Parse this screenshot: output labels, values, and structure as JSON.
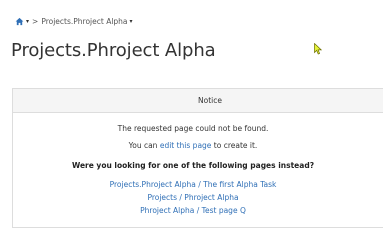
{
  "breadcrumb": {
    "home_icon": "home-icon",
    "caret": "▾",
    "separator": ">",
    "current": "Projects.Phroject Alpha"
  },
  "page_title": "Projects.Phroject Alpha",
  "notice": {
    "header": "Notice",
    "message": "The requested page could not be found.",
    "create_prefix": "You can ",
    "create_link": "edit this page",
    "create_suffix": " to create it.",
    "suggestion_heading": "Were you looking for one of the following pages instead?",
    "suggestions": [
      "Projects.Phroject Alpha / The first Alpha Task",
      "Projects / Phroject Alpha",
      "Phroject Alpha / Test page Q"
    ]
  },
  "colors": {
    "link": "#2f6fb6",
    "header_bg": "#f5f5f5",
    "border": "#dddddd",
    "cursor": "#e6f53a"
  }
}
